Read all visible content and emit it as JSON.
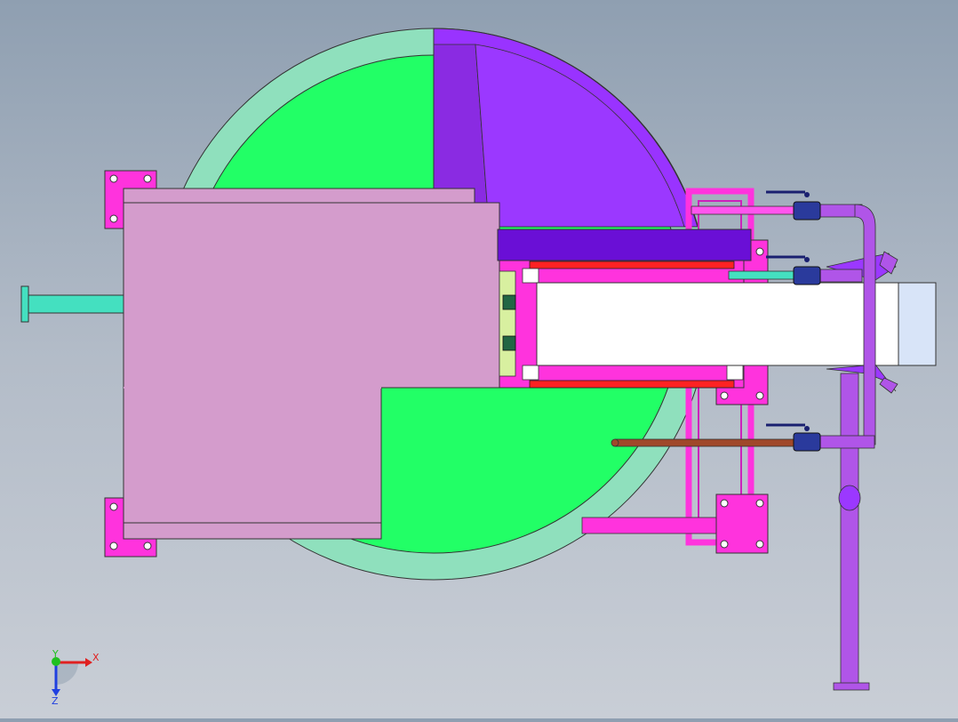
{
  "viewport": {
    "background_top": "#8f9fb1",
    "background_bottom": "#c9ced6"
  },
  "colors": {
    "disc_ring": "#8fe0bd",
    "disc_fill": "#22ff66",
    "sector_purple": "#9933ff",
    "sector_dark": "#8a2be2",
    "plate": "#d49ccc",
    "frame": "#ff33dd",
    "pipe_purple": "#b055e8",
    "pipe_teal": "#44e0c0",
    "pipe_copper": "#a0482a",
    "valve_blue": "#2a3a9c",
    "heater_red": "#ff2222",
    "block_white": "#ffffff",
    "end_cap": "#d8e4f8"
  },
  "triad": {
    "x_label": "X",
    "y_label": "Y",
    "z_label": "Z",
    "x_color": "#e02020",
    "y_color": "#20c020",
    "z_color": "#2040e0"
  }
}
